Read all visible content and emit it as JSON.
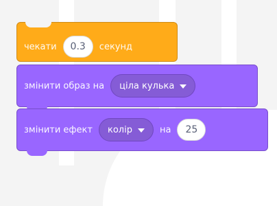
{
  "blocks": {
    "wait": {
      "label_before": "чекати",
      "value": "0.3",
      "label_after": "секунд"
    },
    "switch_costume": {
      "label": "змінити образ на",
      "dropdown_value": "ціла кулька"
    },
    "change_effect": {
      "label": "змінити ефект",
      "dropdown_value": "колір",
      "label_by": "на",
      "value": "25"
    }
  },
  "colors": {
    "control": "#ffab19",
    "looks": "#9966ff",
    "looks_dropdown": "#855cd6"
  },
  "icons": {
    "dropdown": "chevron-down-icon"
  }
}
